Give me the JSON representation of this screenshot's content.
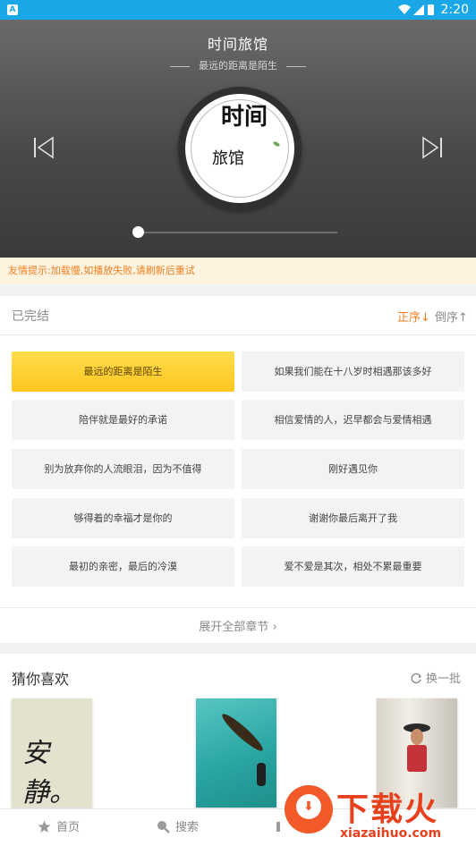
{
  "status_bar": {
    "app_icon": "A",
    "time": "2:20",
    "icons": [
      "wifi-icon",
      "signal-icon",
      "battery-icon"
    ],
    "color": "#1aa7e8"
  },
  "player": {
    "title": "时间旅馆",
    "current_chapter": "最远的距离是陌生",
    "cover": {
      "calligraphy_1": "时间",
      "calligraphy_2": "旅馆"
    },
    "progress": 0.0,
    "prev_icon": "skip-previous-icon",
    "next_icon": "skip-next-icon"
  },
  "notice": {
    "text": "友情提示:加载慢,如播放失败,请刷新后重试",
    "color": "#f08023"
  },
  "chapters": {
    "status": "已完结",
    "sort_asc": "正序↓",
    "sort_desc": "倒序↑",
    "active_color": "#ffcf2e",
    "items": [
      {
        "label": "最远的距离是陌生",
        "active": true
      },
      {
        "label": "如果我们能在十八岁时相遇那该多好",
        "active": false
      },
      {
        "label": "陪伴就是最好的承诺",
        "active": false
      },
      {
        "label": "相信爱情的人，迟早都会与爱情相遇",
        "active": false
      },
      {
        "label": "别为放弃你的人流眼泪，因为不值得",
        "active": false
      },
      {
        "label": "刚好遇见你",
        "active": false
      },
      {
        "label": "够得着的幸福才是你的",
        "active": false
      },
      {
        "label": "谢谢你最后离开了我",
        "active": false
      },
      {
        "label": "最初的亲密，最后的冷漠",
        "active": false
      },
      {
        "label": "爱不爱是其次，相处不累最重要",
        "active": false
      }
    ],
    "expand": "展开全部章节 ›"
  },
  "guess": {
    "title": "猜你喜欢",
    "refresh": "换一批",
    "books": [
      {
        "cover_text": "安静。"
      },
      {
        "cover_text": ""
      },
      {
        "cover_text": ""
      }
    ]
  },
  "bottom_nav": {
    "home": "首页",
    "search": "搜索"
  },
  "watermark": {
    "brand": "下载火",
    "url": "xiazaihuo.com"
  }
}
